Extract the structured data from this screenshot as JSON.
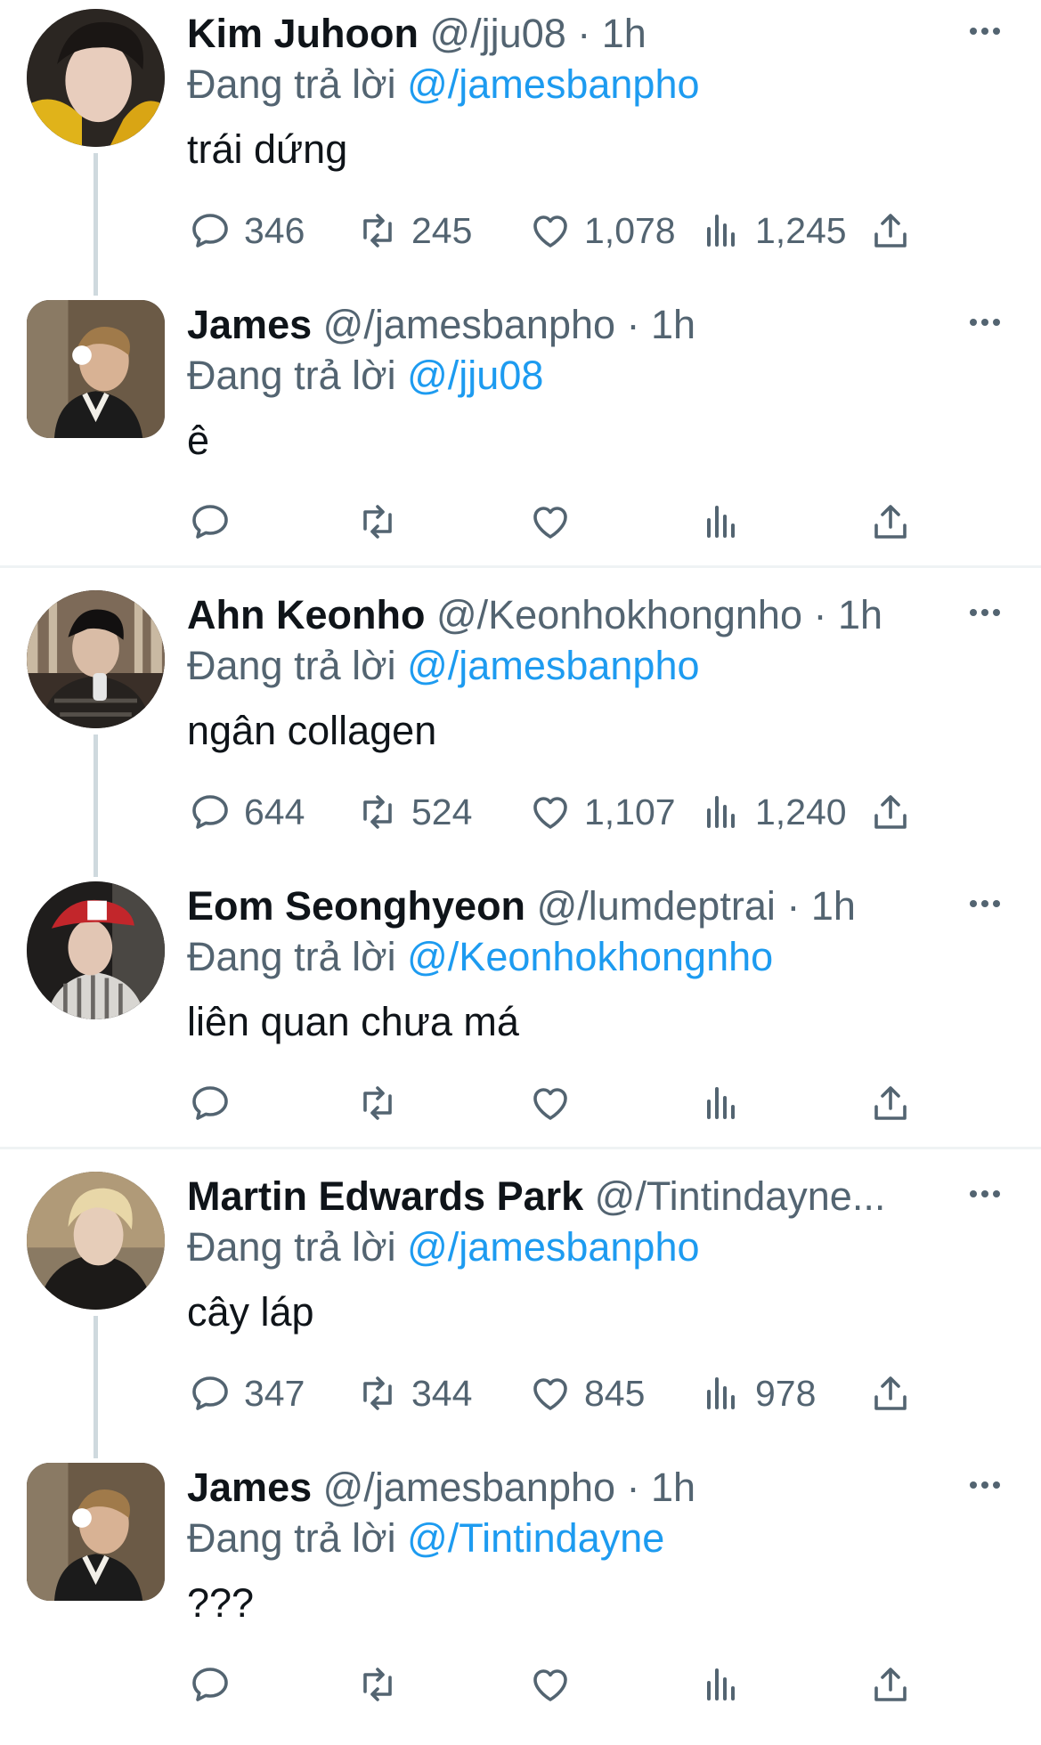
{
  "tweets": [
    {
      "display_name": "Kim Juhoon",
      "handle": "@/jju08",
      "time": "· 1h",
      "reply_prefix": "Đang trả lời",
      "reply_to": "@/jamesbanpho",
      "text": "trái dứng",
      "stats": {
        "replies": "346",
        "retweets": "245",
        "likes": "1,078",
        "views": "1,245"
      },
      "avatar_icon": "avatar-photo-kim-juhoon"
    },
    {
      "display_name": "James",
      "handle": "@/jamesbanpho",
      "time": "· 1h",
      "reply_prefix": "Đang trả lời",
      "reply_to": "@/jju08",
      "text": "ê",
      "stats": {
        "replies": "",
        "retweets": "",
        "likes": "",
        "views": ""
      },
      "avatar_icon": "avatar-photo-james"
    },
    {
      "display_name": "Ahn Keonho",
      "handle": "@/Keonhokhongnho",
      "time": "· 1h",
      "reply_prefix": "Đang trả lời",
      "reply_to": "@/jamesbanpho",
      "text": "ngân collagen",
      "stats": {
        "replies": "644",
        "retweets": "524",
        "likes": "1,107",
        "views": "1,240"
      },
      "avatar_icon": "avatar-photo-ahn-keonho"
    },
    {
      "display_name": "Eom Seonghyeon",
      "handle": "@/lumdeptrai",
      "time": "· 1h",
      "reply_prefix": "Đang trả lời",
      "reply_to": "@/Keonhokhongnho",
      "text": "liên quan chưa má",
      "stats": {
        "replies": "",
        "retweets": "",
        "likes": "",
        "views": ""
      },
      "avatar_icon": "avatar-photo-eom-seonghyeon"
    },
    {
      "display_name": "Martin Edwards Park",
      "handle": "@/Tintindayne...",
      "time": "",
      "reply_prefix": "Đang trả lời",
      "reply_to": "@/jamesbanpho",
      "text": "cây láp",
      "stats": {
        "replies": "347",
        "retweets": "344",
        "likes": "845",
        "views": "978"
      },
      "avatar_icon": "avatar-photo-martin-edwards-park"
    },
    {
      "display_name": "James",
      "handle": "@/jamesbanpho",
      "time": "· 1h",
      "reply_prefix": "Đang trả lời",
      "reply_to": "@/Tintindayne",
      "text": "???",
      "stats": {
        "replies": "",
        "retweets": "",
        "likes": "",
        "views": ""
      },
      "avatar_icon": "avatar-photo-james"
    }
  ],
  "colors": {
    "link": "#1d9bf0",
    "secondary_text": "#536471",
    "primary_text": "#0f1419",
    "thread_line": "#cfd9de",
    "divider": "#eff3f4"
  },
  "icons": [
    "reply-icon",
    "retweet-icon",
    "like-icon",
    "views-icon",
    "share-icon",
    "more-icon"
  ]
}
